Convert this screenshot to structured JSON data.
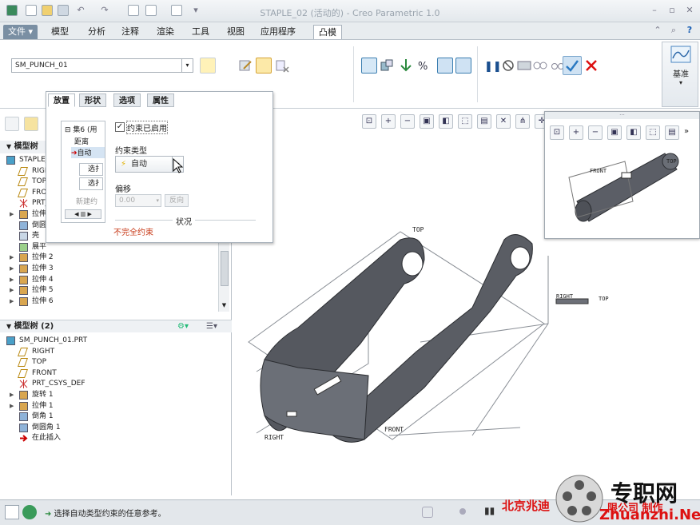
{
  "window": {
    "title": "STAPLE_02 (活动的) - Creo Parametric 1.0"
  },
  "menu": {
    "file": "文件",
    "tabs": [
      "模型",
      "分析",
      "注释",
      "渲染",
      "工具",
      "视图",
      "应用程序",
      "凸模"
    ]
  },
  "ribbon": {
    "component_select": "SM_PUNCH_01",
    "datum_label": "基准"
  },
  "dashboard": {
    "tabs": [
      "放置",
      "形状",
      "选项",
      "属性"
    ],
    "set_label": "集6 (用",
    "list_items": [
      "距离",
      "自动"
    ],
    "sel_btns": [
      "选扌",
      "选扌"
    ],
    "new_constraint": "新建约",
    "enabled_check": "约束已启用",
    "constraint_type_label": "约束类型",
    "constraint_type_value": "自动",
    "offset_label": "偏移",
    "offset_value": "0.00",
    "flip_btn": "反向",
    "status_label": "状况",
    "status_value": "不完全约束"
  },
  "tree1": {
    "title": "模型树",
    "items": [
      {
        "label": "STAPLE_",
        "icon": "part"
      },
      {
        "label": "RIGH",
        "icon": "plane"
      },
      {
        "label": "TOP",
        "icon": "plane"
      },
      {
        "label": "FRON",
        "icon": "plane"
      },
      {
        "label": "PRT_",
        "icon": "csys"
      },
      {
        "label": "拉伸",
        "icon": "ext"
      },
      {
        "label": "倒圆",
        "icon": "round"
      },
      {
        "label": "壳",
        "icon": "shell"
      },
      {
        "label": "展平",
        "icon": "flat"
      },
      {
        "label": "拉伸 2",
        "icon": "ext"
      },
      {
        "label": "拉伸 3",
        "icon": "ext"
      },
      {
        "label": "拉伸 4",
        "icon": "ext"
      },
      {
        "label": "拉伸 5",
        "icon": "ext"
      },
      {
        "label": "拉伸 6",
        "icon": "ext"
      }
    ]
  },
  "tree2": {
    "title": "模型树 (2)",
    "items": [
      {
        "label": "SM_PUNCH_01.PRT",
        "icon": "part"
      },
      {
        "label": "RIGHT",
        "icon": "plane"
      },
      {
        "label": "TOP",
        "icon": "plane"
      },
      {
        "label": "FRONT",
        "icon": "plane"
      },
      {
        "label": "PRT_CSYS_DEF",
        "icon": "csys"
      },
      {
        "label": "旋转 1",
        "icon": "rev"
      },
      {
        "label": "拉伸 1",
        "icon": "ext"
      },
      {
        "label": "倒角 1",
        "icon": "chamfer"
      },
      {
        "label": "倒圆角 1",
        "icon": "round"
      },
      {
        "label": "在此插入",
        "icon": "insert"
      }
    ]
  },
  "viewport": {
    "labels": {
      "top1": "TOP",
      "right": "RIGHT",
      "top2": "TOP",
      "front": "FRONT",
      "right2": "RIGHT"
    }
  },
  "mini": {
    "labels": {
      "front": "FRONT",
      "top": "TOP"
    }
  },
  "status": {
    "message": "选择自动类型约束的任意参考。"
  },
  "watermark": {
    "left": "北京兆迪",
    "middle": "限公司 制作",
    "brand": "专职网",
    "url": "Zhuanzhi.Net"
  }
}
